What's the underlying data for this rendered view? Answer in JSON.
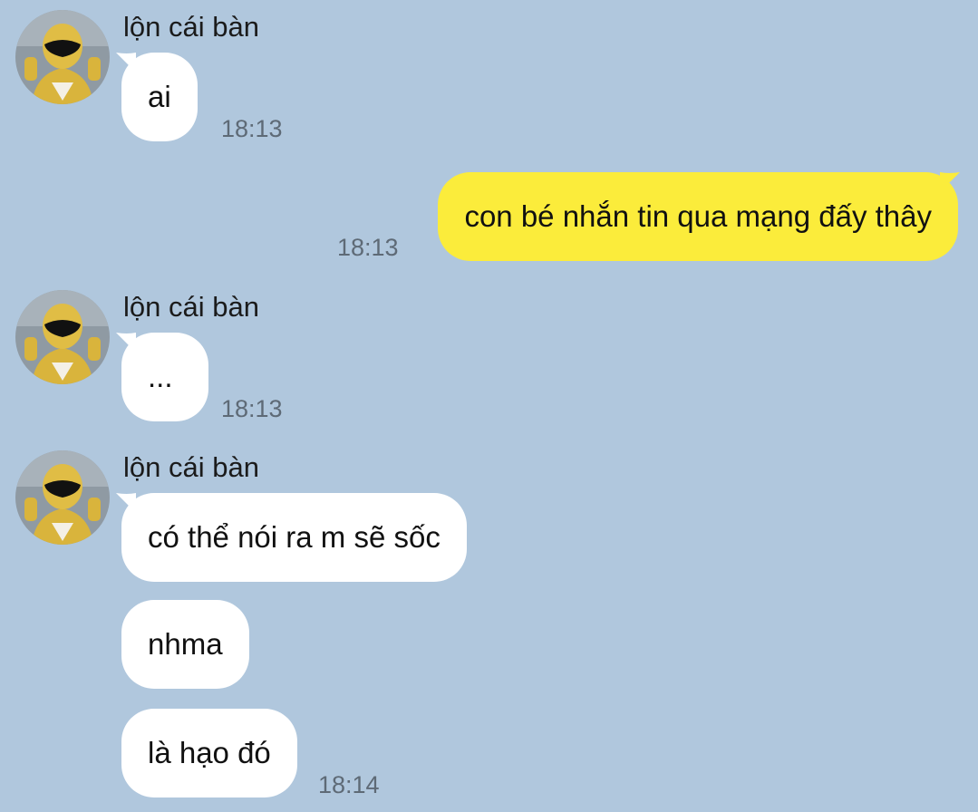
{
  "sender_name": "lộn cái bàn",
  "messages": [
    {
      "text": "ai",
      "time": "18:13"
    },
    {
      "text": "con bé nhắn tin qua mạng đấy thây",
      "time": "18:13"
    },
    {
      "text": "...",
      "time": "18:13"
    },
    {
      "text": "có thể nói ra m sẽ sốc",
      "time": ""
    },
    {
      "text": "nhma",
      "time": ""
    },
    {
      "text": "là hạo đó",
      "time": "18:14"
    }
  ],
  "colors": {
    "background": "#b0c7dd",
    "incoming_bubble": "#ffffff",
    "outgoing_bubble": "#fbec3b",
    "timestamp": "#5e6a76"
  },
  "icons": {
    "avatar": "yellow-ranger-avatar"
  }
}
